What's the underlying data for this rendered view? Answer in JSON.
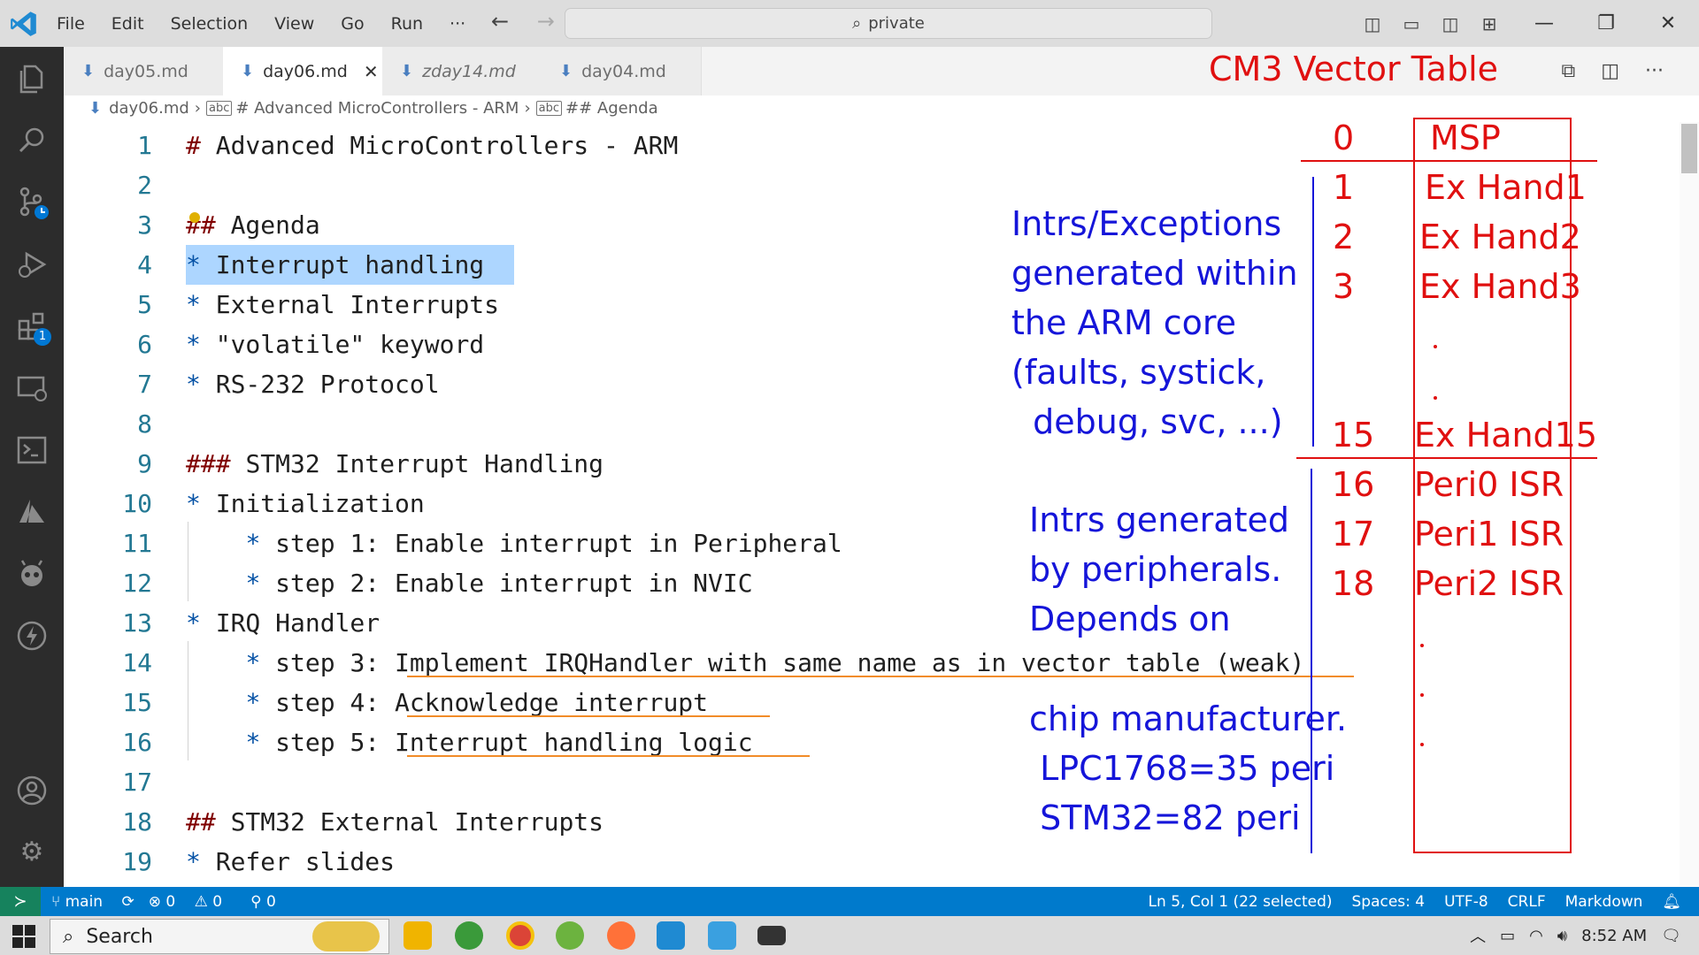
{
  "menu": [
    "File",
    "Edit",
    "Selection",
    "View",
    "Go",
    "Run",
    "···"
  ],
  "command_center": "private",
  "tabs": [
    {
      "label": "day05.md",
      "active": false
    },
    {
      "label": "day06.md",
      "active": true
    },
    {
      "label": "zday14.md",
      "active": false
    },
    {
      "label": "day04.md",
      "active": false
    }
  ],
  "breadcrumb": [
    "day06.md",
    "# Advanced MicroControllers - ARM",
    "## Agenda"
  ],
  "lines": [
    {
      "n": "1",
      "text": "Advanced MicroControllers - ARM",
      "marker": "#"
    },
    {
      "n": "2",
      "text": ""
    },
    {
      "n": "3",
      "text": "Agenda",
      "marker": "##"
    },
    {
      "n": "4",
      "text": "Interrupt handling",
      "marker": "*"
    },
    {
      "n": "5",
      "text": "External Interrupts",
      "marker": "*"
    },
    {
      "n": "6",
      "text": "\"volatile\" keyword",
      "marker": "*"
    },
    {
      "n": "7",
      "text": "RS-232 Protocol",
      "marker": "*"
    },
    {
      "n": "8",
      "text": ""
    },
    {
      "n": "9",
      "text": "STM32 Interrupt Handling",
      "marker": "###"
    },
    {
      "n": "10",
      "text": "Initialization",
      "marker": "*"
    },
    {
      "n": "11",
      "text": "step 1: Enable interrupt in Peripheral",
      "marker": "*"
    },
    {
      "n": "12",
      "text": "step 2: Enable interrupt in NVIC",
      "marker": "*"
    },
    {
      "n": "13",
      "text": "IRQ Handler",
      "marker": "*"
    },
    {
      "n": "14",
      "text": "step 3: Implement IRQHandler with same name as in vector table (weak)",
      "marker": "*"
    },
    {
      "n": "15",
      "text": "step 4: Acknowledge interrupt",
      "marker": "*"
    },
    {
      "n": "16",
      "text": "step 5: Interrupt handling logic",
      "marker": "*"
    },
    {
      "n": "17",
      "text": ""
    },
    {
      "n": "18",
      "text": "STM32 External Interrupts",
      "marker": "##"
    },
    {
      "n": "19",
      "text": "Refer slides",
      "marker": "*"
    }
  ],
  "annotations": {
    "title": "CM3 Vector Table",
    "core_note": "Intrs/Exceptions\ngenerated within\nthe ARM core\n(faults, systick,\n  debug, svc, ...)",
    "peri_note": "Intrs generated\nby peripherals.\nDepends on",
    "chip_note": "chip manufacturer.\n LPC1768=35 peri\n STM32=82 peri",
    "vector_table": [
      {
        "num": "0",
        "entry": "MSP"
      },
      {
        "num": "1",
        "entry": "Ex Hand1"
      },
      {
        "num": "2",
        "entry": "Ex Hand2"
      },
      {
        "num": "3",
        "entry": "Ex Hand3"
      },
      {
        "num": "15",
        "entry": "Ex Hand15"
      },
      {
        "num": "16",
        "entry": "Peri0 ISR"
      },
      {
        "num": "17",
        "entry": "Peri1 ISR"
      },
      {
        "num": "18",
        "entry": "Peri2 ISR"
      }
    ]
  },
  "status": {
    "branch": "main",
    "errors": "0",
    "warnings": "0",
    "ports": "0",
    "position": "Ln 5, Col 1 (22 selected)",
    "spaces": "Spaces: 4",
    "encoding": "UTF-8",
    "eol": "CRLF",
    "language": "Markdown"
  },
  "taskbar": {
    "search": "Search",
    "time": "8:52 AM"
  },
  "colors": {
    "accent": "#007acc",
    "annotation_blue": "#1515d9",
    "annotation_red": "#e01010"
  }
}
